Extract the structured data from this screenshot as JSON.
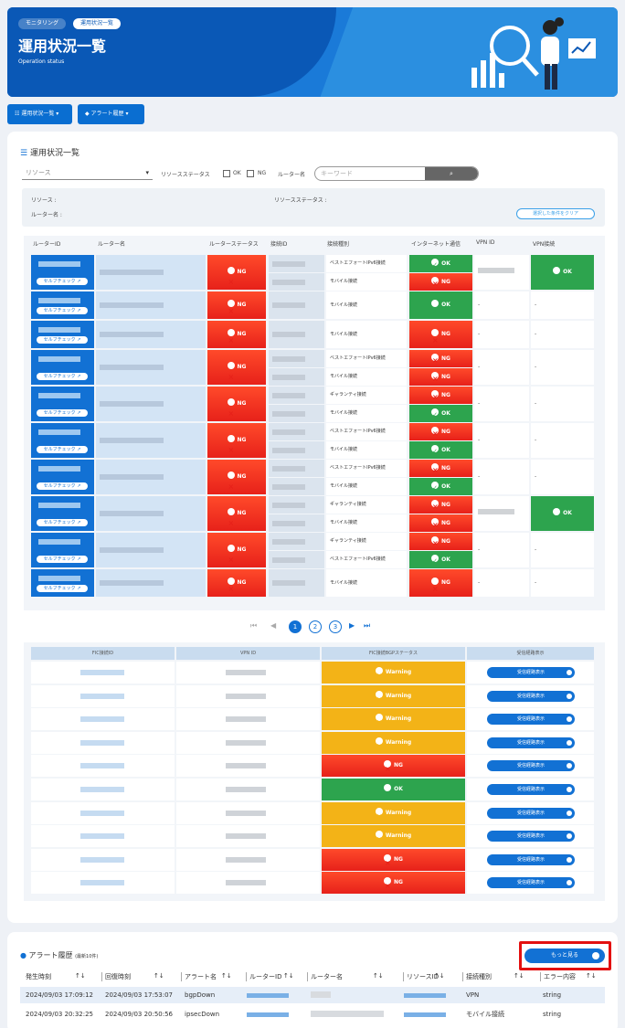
{
  "header": {
    "breadcrumb": [
      "モニタリング",
      "運用状況一覧"
    ],
    "title": "運用状況一覧",
    "subtitle": "Operation status"
  },
  "top_buttons": [
    {
      "label": "運用状況一覧",
      "icon": "list-icon"
    },
    {
      "label": "アラート履歴",
      "icon": "bell-icon"
    }
  ],
  "panel": {
    "title": "運用状況一覧",
    "resource_select": "リソース",
    "resource_status_label": "リソースステータス",
    "ok_label": "OK",
    "ng_label": "NG",
    "router_name_label": "ルーター名",
    "keyword_placeholder": "キーワード",
    "filter": {
      "resource": "リソース :",
      "resource_status": "リソースステータス :",
      "router_name": "ルーター名 :",
      "clear_button": "選択した条件をクリア"
    }
  },
  "table1": {
    "headers": [
      "ルーターID",
      "ルーター名",
      "ルーターステータス",
      "接続ID",
      "接続種別",
      "インターネット通信",
      "VPN ID",
      "VPN接続"
    ],
    "self_check_label": "セルフチェック",
    "rows": [
      {
        "status": "NG",
        "conns": [
          {
            "type": "ベストエフォートIPv6接続",
            "net": "OK"
          },
          {
            "type": "モバイル接続",
            "net": "NG"
          }
        ],
        "vpn": "",
        "vpn_conn": "OK"
      },
      {
        "status": "NG",
        "conns": [
          {
            "type": "モバイル接続",
            "net": "OK"
          }
        ],
        "vpn": "-",
        "vpn_conn": "-"
      },
      {
        "status": "NG",
        "conns": [
          {
            "type": "モバイル接続",
            "net": "NG"
          }
        ],
        "vpn": "-",
        "vpn_conn": "-"
      },
      {
        "status": "NG",
        "conns": [
          {
            "type": "ベストエフォートIPv6接続",
            "net": "NG"
          },
          {
            "type": "モバイル接続",
            "net": "NG"
          }
        ],
        "vpn": "-",
        "vpn_conn": "-"
      },
      {
        "status": "NG",
        "conns": [
          {
            "type": "ギャランティ接続",
            "net": "NG"
          },
          {
            "type": "モバイル接続",
            "net": "OK"
          }
        ],
        "vpn": "-",
        "vpn_conn": "-"
      },
      {
        "status": "NG",
        "conns": [
          {
            "type": "ベストエフォートIPv6接続",
            "net": "NG"
          },
          {
            "type": "モバイル接続",
            "net": "OK"
          }
        ],
        "vpn": "-",
        "vpn_conn": "-"
      },
      {
        "status": "NG",
        "conns": [
          {
            "type": "ベストエフォートIPv6接続",
            "net": "NG"
          },
          {
            "type": "モバイル接続",
            "net": "OK"
          }
        ],
        "vpn": "-",
        "vpn_conn": "-"
      },
      {
        "status": "NG",
        "conns": [
          {
            "type": "ギャランティ接続",
            "net": "NG"
          },
          {
            "type": "モバイル接続",
            "net": "NG"
          }
        ],
        "vpn": "",
        "vpn_conn": "OK"
      },
      {
        "status": "NG",
        "conns": [
          {
            "type": "ギャランティ接続",
            "net": "NG"
          },
          {
            "type": "ベストエフォートIPv6接続",
            "net": "OK"
          }
        ],
        "vpn": "-",
        "vpn_conn": "-"
      },
      {
        "status": "NG",
        "conns": [
          {
            "type": "モバイル接続",
            "net": "NG"
          }
        ],
        "vpn": "-",
        "vpn_conn": "-"
      }
    ]
  },
  "pager": {
    "pages": [
      "1",
      "2",
      "3"
    ],
    "current": "1"
  },
  "table2": {
    "headers": [
      "FIC接続ID",
      "VPN ID",
      "FIC接続BGPステータス",
      "受信経路表示"
    ],
    "button_label": "受信経路表示",
    "statuses": [
      "Warning",
      "Warning",
      "Warning",
      "Warning",
      "NG",
      "OK",
      "Warning",
      "Warning",
      "NG",
      "NG"
    ]
  },
  "alerts": {
    "title": "アラート履歴",
    "subtitle": "(最新10件)",
    "more_button": "もっと見る",
    "headers": [
      "発生時刻",
      "回復時刻",
      "アラート名",
      "ルーターID",
      "ルーター名",
      "リソースID",
      "接続種別",
      "エラー内容"
    ],
    "sort_icon": "↑↓",
    "rows": [
      {
        "occurred": "2024/09/03 17:09:12",
        "recovered": "2024/09/03 17:53:07",
        "name": "bgpDown",
        "conn_type": "VPN",
        "error": "string"
      },
      {
        "occurred": "2024/09/03 20:32:25",
        "recovered": "2024/09/03 20:50:56",
        "name": "ipsecDown",
        "conn_type": "モバイル接続",
        "error": "string"
      }
    ]
  },
  "colors": {
    "primary": "#1271d4",
    "ng": "#e7211a",
    "ok": "#2da44e",
    "warning": "#f3b317",
    "highlight": "#e31010"
  }
}
